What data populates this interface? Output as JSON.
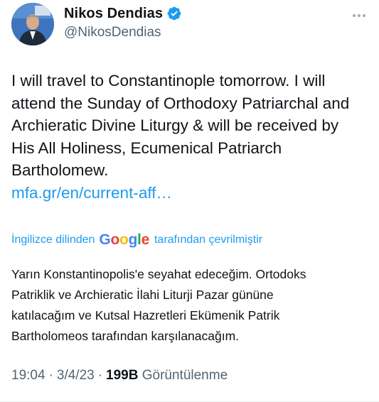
{
  "author": {
    "display_name": "Nikos Dendias",
    "handle": "@NikosDendias",
    "verified": true,
    "avatar_icon": "avatar-portrait-icon"
  },
  "tweet": {
    "lines": [
      "I will travel to Constantinople tomorrow.  I will",
      "attend the Sunday of Orthodoxy Patriarchal and",
      "Archieratic Divine Liturgy & will be received by",
      "His All Holiness, Ecumenical Patriarch",
      "Bartholomew."
    ],
    "link_text": "mfa.gr/en/current-aff…"
  },
  "translation": {
    "prefix": "İngilizce dilinden",
    "google_letters": [
      "G",
      "o",
      "o",
      "g",
      "l",
      "e"
    ],
    "suffix": "tarafından çevrilmiştir",
    "lines": [
      "Yarın Konstantinopolis'e seyahat edeceğim. Ortodoks",
      "Patriklik ve Archieratic İlahi Liturji Pazar gününe",
      "katılacağım ve Kutsal Hazretleri Ekümenik Patrik",
      "Bartholomeos tarafından karşılanacağım."
    ]
  },
  "meta": {
    "time": "19:04",
    "separator": "·",
    "date": "3/4/23",
    "views_count": "199B",
    "views_label": "Görüntülenme"
  },
  "colors": {
    "link": "#1d9bf0",
    "text": "#0f1419",
    "muted": "#536471",
    "verified_badge": "#1d9bf0"
  }
}
